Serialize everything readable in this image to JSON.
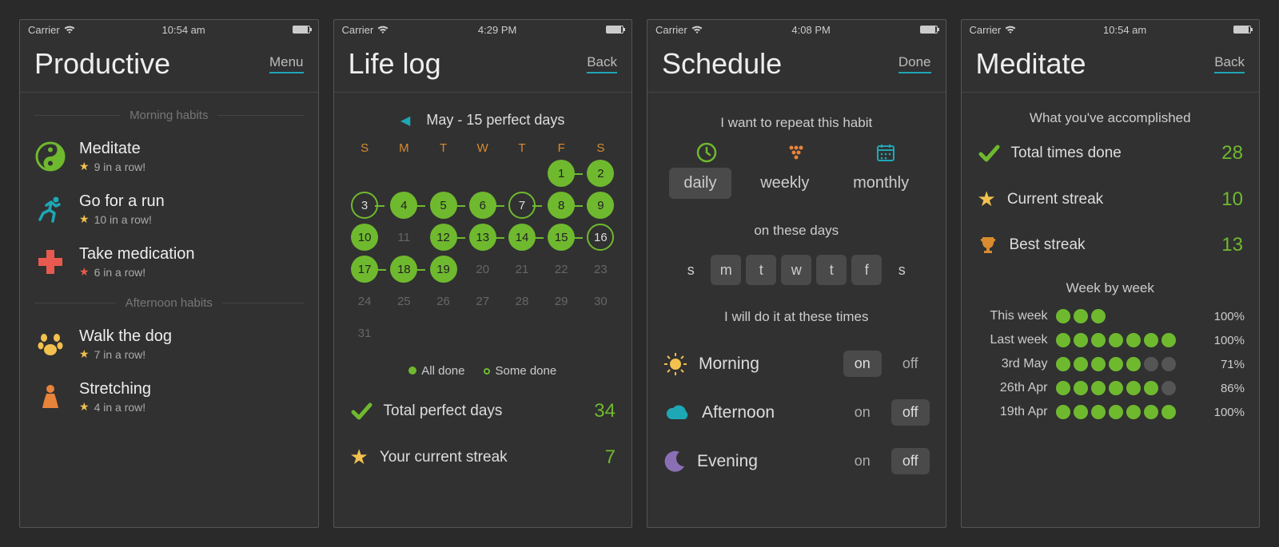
{
  "screens": [
    {
      "statusbar": {
        "carrier": "Carrier",
        "time": "10:54 am"
      },
      "header": {
        "title": "Productive",
        "link": "Menu"
      },
      "section1": "Morning habits",
      "section2": "Afternoon habits",
      "habits": [
        {
          "name": "Meditate",
          "sub": "9 in a row!",
          "icon": "yinyang",
          "color": "#6fb92f",
          "star": "yellow"
        },
        {
          "name": "Go for a run",
          "sub": "10 in a row!",
          "icon": "run",
          "color": "#1ea7b5",
          "star": "yellow"
        },
        {
          "name": "Take medication",
          "sub": "6 in a row!",
          "icon": "cross",
          "color": "#e85a4f",
          "star": "red"
        },
        {
          "name": "Walk the dog",
          "sub": "7 in a row!",
          "icon": "paw",
          "color": "#f2c14e",
          "star": "yellow"
        },
        {
          "name": "Stretching",
          "sub": "4 in a row!",
          "icon": "stretch",
          "color": "#e8833a",
          "star": "yellow"
        }
      ]
    },
    {
      "statusbar": {
        "carrier": "Carrier",
        "time": "4:29 PM"
      },
      "header": {
        "title": "Life log",
        "link": "Back"
      },
      "month_title": "May - 15 perfect days",
      "dow": [
        "S",
        "M",
        "T",
        "W",
        "T",
        "F",
        "S"
      ],
      "calendar": [
        [
          null,
          null,
          null,
          null,
          null,
          {
            "d": 1,
            "s": "done",
            "n": true
          },
          {
            "d": 2,
            "s": "done"
          }
        ],
        [
          {
            "d": 3,
            "s": "some",
            "n": true
          },
          {
            "d": 4,
            "s": "done",
            "n": true
          },
          {
            "d": 5,
            "s": "done",
            "n": true
          },
          {
            "d": 6,
            "s": "done",
            "n": true
          },
          {
            "d": 7,
            "s": "some",
            "n": true
          },
          {
            "d": 8,
            "s": "done",
            "n": true
          },
          {
            "d": 9,
            "s": "done"
          }
        ],
        [
          {
            "d": 10,
            "s": "done"
          },
          {
            "d": 11,
            "s": "empty"
          },
          {
            "d": 12,
            "s": "done",
            "n": true
          },
          {
            "d": 13,
            "s": "done",
            "n": true
          },
          {
            "d": 14,
            "s": "done",
            "n": true
          },
          {
            "d": 15,
            "s": "done",
            "n": true
          },
          {
            "d": 16,
            "s": "some"
          }
        ],
        [
          {
            "d": 17,
            "s": "done",
            "n": true
          },
          {
            "d": 18,
            "s": "done",
            "n": true
          },
          {
            "d": 19,
            "s": "done"
          },
          {
            "d": 20,
            "s": "future"
          },
          {
            "d": 21,
            "s": "future"
          },
          {
            "d": 22,
            "s": "future"
          },
          {
            "d": 23,
            "s": "future"
          }
        ],
        [
          {
            "d": 24,
            "s": "future"
          },
          {
            "d": 25,
            "s": "future"
          },
          {
            "d": 26,
            "s": "future"
          },
          {
            "d": 27,
            "s": "future"
          },
          {
            "d": 28,
            "s": "future"
          },
          {
            "d": 29,
            "s": "future"
          },
          {
            "d": 30,
            "s": "future"
          }
        ],
        [
          {
            "d": 31,
            "s": "future"
          },
          null,
          null,
          null,
          null,
          null,
          null
        ]
      ],
      "legend": {
        "all": "All done",
        "some": "Some done"
      },
      "stats": [
        {
          "icon": "check",
          "label": "Total perfect days",
          "value": "34"
        },
        {
          "icon": "star",
          "label": "Your current streak",
          "value": "7"
        }
      ]
    },
    {
      "statusbar": {
        "carrier": "Carrier",
        "time": "4:08 PM"
      },
      "header": {
        "title": "Schedule",
        "link": "Done"
      },
      "repeat_label": "I want to repeat this habit",
      "repeat_opts": [
        {
          "label": "daily",
          "active": true
        },
        {
          "label": "weekly",
          "active": false
        },
        {
          "label": "monthly",
          "active": false
        }
      ],
      "days_label": "on these days",
      "days": [
        {
          "l": "s",
          "on": false
        },
        {
          "l": "m",
          "on": true
        },
        {
          "l": "t",
          "on": true
        },
        {
          "l": "w",
          "on": true
        },
        {
          "l": "t",
          "on": true
        },
        {
          "l": "f",
          "on": true
        },
        {
          "l": "s",
          "on": false
        }
      ],
      "times_label": "I will do it at these times",
      "times": [
        {
          "label": "Morning",
          "icon": "sun",
          "color": "#f2c14e",
          "value": "on"
        },
        {
          "label": "Afternoon",
          "icon": "cloud",
          "color": "#1ea7b5",
          "value": "off"
        },
        {
          "label": "Evening",
          "icon": "moon",
          "color": "#8a6fb5",
          "value": "off"
        }
      ],
      "toggle": {
        "on": "on",
        "off": "off"
      }
    },
    {
      "statusbar": {
        "carrier": "Carrier",
        "time": "10:54 am"
      },
      "header": {
        "title": "Meditate",
        "link": "Back"
      },
      "accomplish": "What you've accomplished",
      "stats": [
        {
          "icon": "check",
          "label": "Total times done",
          "value": "28"
        },
        {
          "icon": "star",
          "label": "Current streak",
          "value": "10"
        },
        {
          "icon": "trophy",
          "label": "Best streak",
          "value": "13"
        }
      ],
      "wbw_label": "Week by week",
      "weeks": [
        {
          "name": "This week",
          "dots": [
            1,
            1,
            1
          ],
          "pct": "100%"
        },
        {
          "name": "Last week",
          "dots": [
            1,
            1,
            1,
            1,
            1,
            1,
            1
          ],
          "pct": "100%"
        },
        {
          "name": "3rd May",
          "dots": [
            1,
            1,
            1,
            1,
            1,
            0,
            0
          ],
          "pct": "71%"
        },
        {
          "name": "26th Apr",
          "dots": [
            1,
            1,
            1,
            1,
            1,
            1,
            0
          ],
          "pct": "86%"
        },
        {
          "name": "19th Apr",
          "dots": [
            1,
            1,
            1,
            1,
            1,
            1,
            1
          ],
          "pct": "100%"
        }
      ]
    }
  ]
}
